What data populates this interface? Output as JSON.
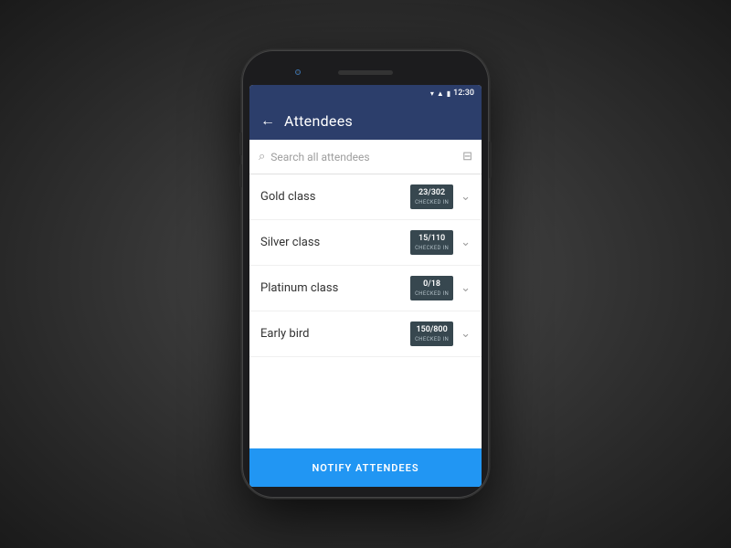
{
  "statusBar": {
    "time": "12:30",
    "wifiIcon": "▾",
    "signalIcon": "▲",
    "batteryIcon": "▮"
  },
  "appBar": {
    "backIcon": "←",
    "title": "Attendees"
  },
  "search": {
    "placeholder": "Search all attendees",
    "searchIcon": "🔍",
    "filterIcon": "▽"
  },
  "attendees": [
    {
      "label": "Gold class",
      "badgeCount": "23/302",
      "badgeLabel": "CHECKED IN"
    },
    {
      "label": "Silver class",
      "badgeCount": "15/110",
      "badgeLabel": "CHECKED IN"
    },
    {
      "label": "Platinum class",
      "badgeCount": "0/18",
      "badgeLabel": "CHECKED IN"
    },
    {
      "label": "Early bird",
      "badgeCount": "150/800",
      "badgeLabel": "CHECKED IN"
    }
  ],
  "notifyButton": {
    "label": "NOTIFY ATTENDEES"
  }
}
